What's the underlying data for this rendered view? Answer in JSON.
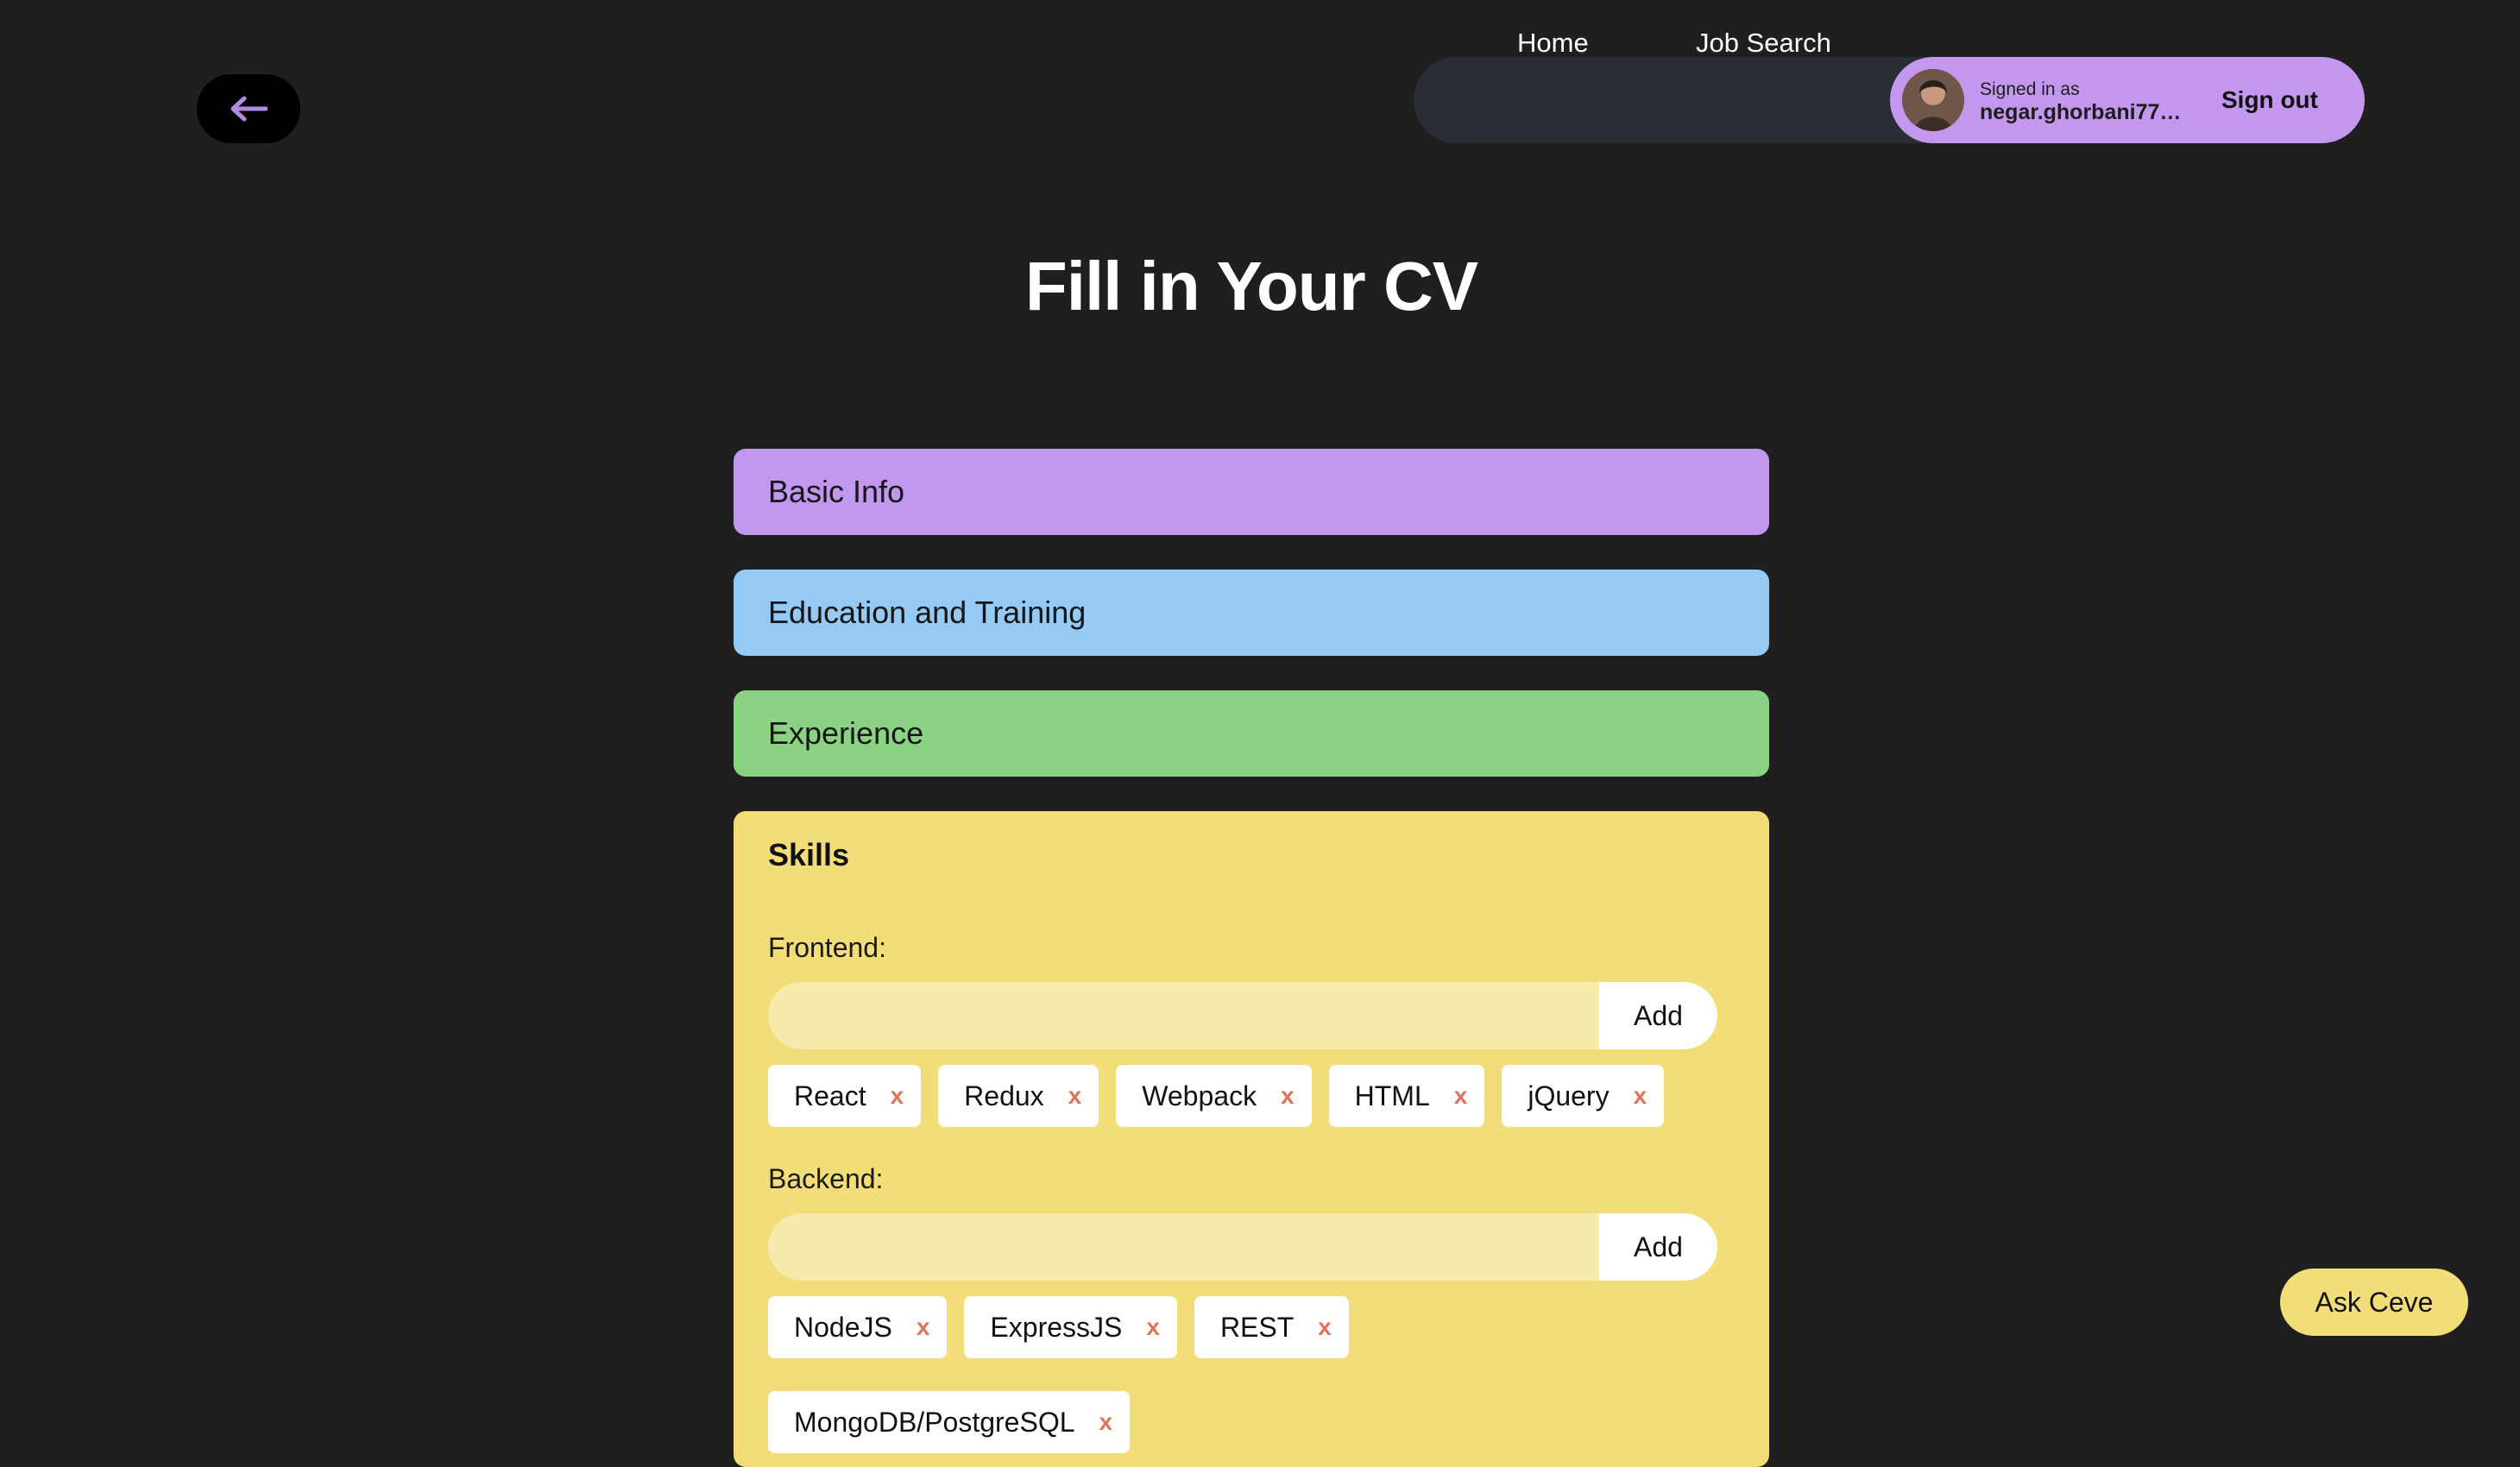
{
  "nav": {
    "back_icon": "arrow-left-icon",
    "links": [
      "Home",
      "Job Search"
    ],
    "user": {
      "signed_label": "Signed in as",
      "email": "negar.ghorbani77@...",
      "sign_out": "Sign out"
    }
  },
  "page": {
    "title": "Fill in Your CV"
  },
  "sections": [
    {
      "label": "Basic Info",
      "color": "#c197ef"
    },
    {
      "label": "Education and Training",
      "color": "#94caf4"
    },
    {
      "label": "Experience",
      "color": "#89d382"
    }
  ],
  "skills": {
    "title": "Skills",
    "add_label": "Add",
    "remove_label": "x",
    "frontend": {
      "label": "Frontend:",
      "input_value": "",
      "tags": [
        "React",
        "Redux",
        "Webpack",
        "HTML",
        "jQuery"
      ]
    },
    "backend": {
      "label": "Backend:",
      "input_value": "",
      "tags": [
        "NodeJS",
        "ExpressJS",
        "REST"
      ],
      "tags_row2": [
        "MongoDB/PostgreSQL"
      ]
    }
  },
  "assistant": {
    "button_label": "Ask Ceve"
  },
  "colors": {
    "background": "#1f1f1f",
    "accent_purple": "#c497ef",
    "skills_yellow": "#f3dd78",
    "remove_x": "#e0735c"
  }
}
